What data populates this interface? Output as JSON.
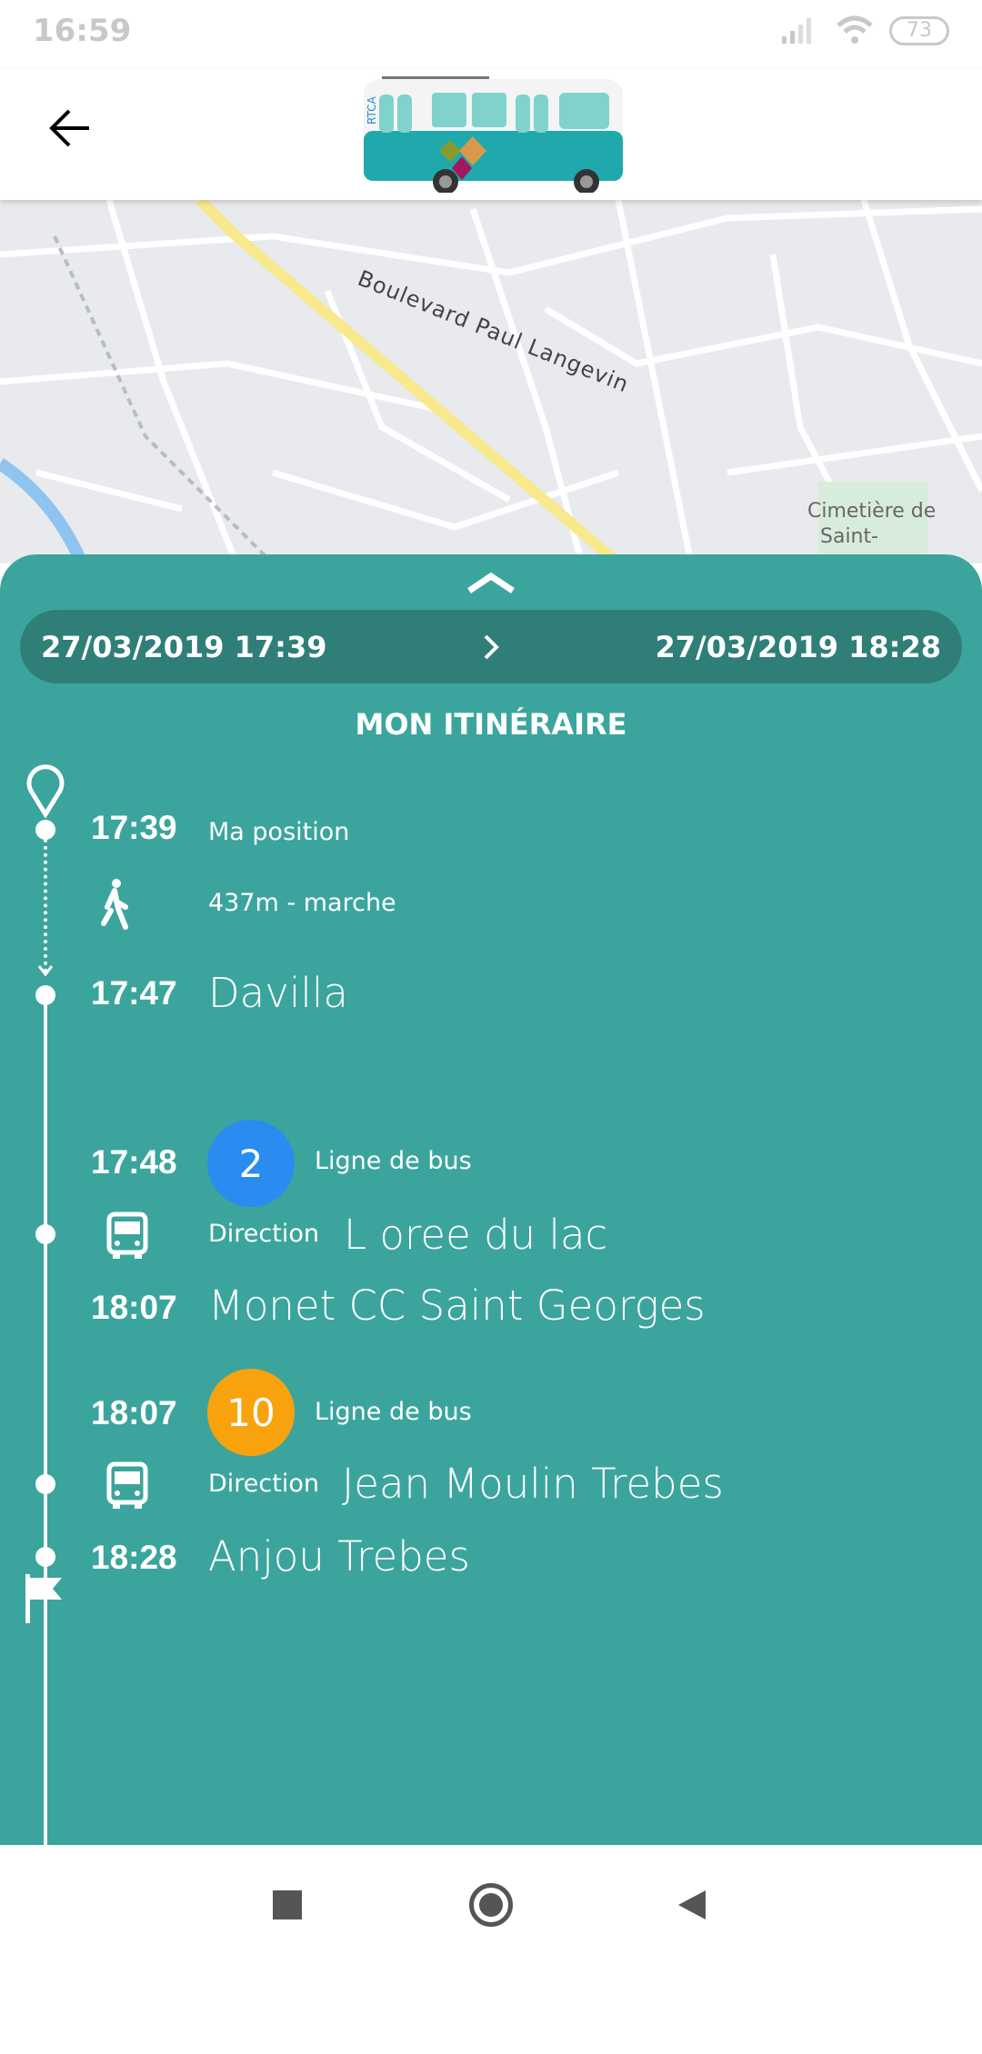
{
  "status_bar": {
    "time": "16:59",
    "battery": "73"
  },
  "header": {
    "back_icon": "arrow-left-icon",
    "logo": "bus-illustration",
    "logo_text": "RTCA"
  },
  "map": {
    "street_label": "Boulevard Paul Langevin",
    "poi_label_1": "Cimetière de",
    "poi_label_2": "Saint-"
  },
  "itinerary": {
    "departure_datetime": "27/03/2019 17:39",
    "arrival_datetime": "27/03/2019 18:28",
    "title": "MON ITINÉRAIRE",
    "start": {
      "time": "17:39",
      "label": "Ma position"
    },
    "walk": {
      "label": "437m - marche"
    },
    "walk_end": {
      "time": "17:47",
      "stop": "Davilla"
    },
    "legs": [
      {
        "start_time": "17:48",
        "line": "2",
        "line_color": "#2a8cf0",
        "line_type": "Ligne de bus",
        "direction_label": "Direction",
        "direction": "L oree du lac",
        "end_time": "18:07",
        "end_stop": "Monet CC Saint Georges"
      },
      {
        "start_time": "18:07",
        "line": "10",
        "line_color": "#f8a30e",
        "line_type": "Ligne de bus",
        "direction_label": "Direction",
        "direction": "Jean Moulin Trebes",
        "end_time": "18:28",
        "end_stop": "Anjou Trebes"
      }
    ]
  },
  "colors": {
    "panel": "#3ba59d",
    "pill": "#2f7f78"
  }
}
